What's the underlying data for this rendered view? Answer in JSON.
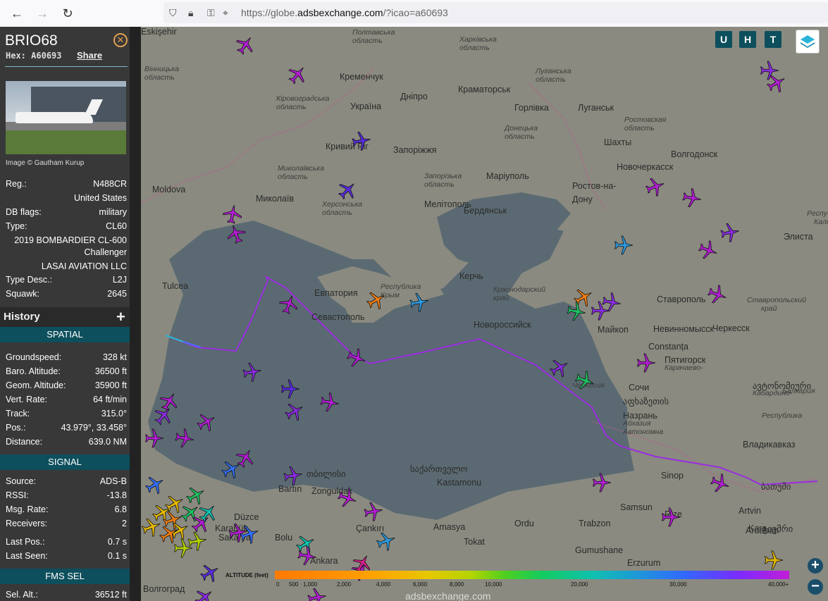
{
  "browser": {
    "url_prefix": "https://globe.",
    "url_domain": "adsbexchange.com",
    "url_path": "/?icao=a60693"
  },
  "aircraft": {
    "callsign": "BRIO68",
    "hex_label": "Hex:",
    "hex": "A60693",
    "share_label": "Share",
    "photo_credit": "Image © Gautham Kurup",
    "details": [
      {
        "key": "Reg.:",
        "value": "N488CR"
      },
      {
        "key": "",
        "value": "United States"
      },
      {
        "key": "DB flags:",
        "value": "military"
      },
      {
        "key": "Type:",
        "value": "CL60"
      }
    ],
    "model_line1": "2019 BOMBARDIER CL-600",
    "model_line2": "Challenger",
    "operator": "LASAI AVIATION LLC",
    "details2": [
      {
        "key": "Type Desc.:",
        "value": "L2J"
      },
      {
        "key": "Squawk:",
        "value": "2645"
      }
    ]
  },
  "history": {
    "title": "History",
    "add_symbol": "+"
  },
  "spatial": {
    "title": "SPATIAL",
    "rows": [
      {
        "key": "Groundspeed:",
        "value": "328 kt"
      },
      {
        "key": "Baro. Altitude:",
        "value": "36500 ft"
      },
      {
        "key": "Geom. Altitude:",
        "value": "35900 ft"
      },
      {
        "key": "Vert. Rate:",
        "value": "64 ft/min"
      },
      {
        "key": "Track:",
        "value": "315.0°"
      },
      {
        "key": "Pos.:",
        "value": "43.979°, 33.458°"
      },
      {
        "key": "Distance:",
        "value": "639.0 NM"
      }
    ]
  },
  "signal": {
    "title": "SIGNAL",
    "rows": [
      {
        "key": "Source:",
        "value": "ADS-B"
      },
      {
        "key": "RSSI:",
        "value": "-13.8"
      },
      {
        "key": "Msg. Rate:",
        "value": "6.8"
      },
      {
        "key": "Receivers:",
        "value": "2"
      },
      {
        "key": "Last Pos.:",
        "value": "0.7 s"
      },
      {
        "key": "Last Seen:",
        "value": "0.1 s"
      }
    ]
  },
  "fms": {
    "title": "FMS SEL",
    "rows": [
      {
        "key": "Sel. Alt.:",
        "value": "36512 ft"
      }
    ]
  },
  "map": {
    "buttons": [
      "U",
      "H",
      "T"
    ],
    "labels": [
      {
        "t": "Полтавська",
        "c": "obl"
      },
      {
        "t": "область",
        "c": "obl"
      },
      {
        "t": "Харківська",
        "c": "obl"
      },
      {
        "t": "область",
        "c": "obl"
      },
      {
        "t": "Кременчук",
        "c": ""
      },
      {
        "t": "Краматорськ",
        "c": ""
      },
      {
        "t": "Луганська",
        "c": "obl"
      },
      {
        "t": "область",
        "c": "obl"
      },
      {
        "t": "Вінницька",
        "c": "obl"
      },
      {
        "t": "область",
        "c": "obl"
      },
      {
        "t": "Кіровоградська",
        "c": "obl"
      },
      {
        "t": "область",
        "c": "obl"
      },
      {
        "t": "Україна",
        "c": ""
      },
      {
        "t": "Дніпро",
        "c": ""
      },
      {
        "t": "Горлівка",
        "c": ""
      },
      {
        "t": "Луганськ",
        "c": ""
      },
      {
        "t": "Ростовская",
        "c": "obl"
      },
      {
        "t": "область",
        "c": "obl"
      },
      {
        "t": "Донецька",
        "c": "obl"
      },
      {
        "t": "область",
        "c": "obl"
      },
      {
        "t": "Шахты",
        "c": ""
      },
      {
        "t": "Кривий Ріг",
        "c": ""
      },
      {
        "t": "Запоріжжя",
        "c": ""
      },
      {
        "t": "Волгодонск",
        "c": ""
      },
      {
        "t": "Миколаївська",
        "c": "obl"
      },
      {
        "t": "область",
        "c": "obl"
      },
      {
        "t": "Запорізька",
        "c": "obl"
      },
      {
        "t": "область",
        "c": "obl"
      },
      {
        "t": "Маріуполь",
        "c": ""
      },
      {
        "t": "Новочеркасск",
        "c": ""
      },
      {
        "t": "Moldova",
        "c": ""
      },
      {
        "t": "Миколаїв",
        "c": ""
      },
      {
        "t": "Херсонська",
        "c": "obl"
      },
      {
        "t": "область",
        "c": "obl"
      },
      {
        "t": "Мелітополь",
        "c": ""
      },
      {
        "t": "Бердянськ",
        "c": ""
      },
      {
        "t": "Ростов-на-",
        "c": ""
      },
      {
        "t": "Дону",
        "c": ""
      },
      {
        "t": "Республи",
        "c": "obl"
      },
      {
        "t": "Калмы",
        "c": "obl"
      },
      {
        "t": "Элиста",
        "c": ""
      },
      {
        "t": "Tulcea",
        "c": ""
      },
      {
        "t": "Евпатория",
        "c": ""
      },
      {
        "t": "Республика",
        "c": "obl"
      },
      {
        "t": "Крым",
        "c": "obl"
      },
      {
        "t": "Керчь",
        "c": ""
      },
      {
        "t": "Краснодарский",
        "c": "obl"
      },
      {
        "t": "край",
        "c": "obl"
      },
      {
        "t": "Ставрополь",
        "c": ""
      },
      {
        "t": "Ставропольский",
        "c": "obl"
      },
      {
        "t": "край",
        "c": "obl"
      },
      {
        "t": "Севастополь",
        "c": ""
      },
      {
        "t": "Новороссийск",
        "c": ""
      },
      {
        "t": "Майкоп",
        "c": ""
      },
      {
        "t": "Невинномысск",
        "c": ""
      },
      {
        "t": "Constanța",
        "c": ""
      },
      {
        "t": "Черкесск",
        "c": ""
      },
      {
        "t": "Пятигорск",
        "c": ""
      },
      {
        "t": "Карачаево-",
        "c": "obl"
      },
      {
        "t": "Черкесия",
        "c": "obl"
      },
      {
        "t": "Сочи",
        "c": ""
      },
      {
        "t": "აფხაზეთის",
        "c": ""
      },
      {
        "t": "ავტონომიური",
        "c": ""
      },
      {
        "t": "Кабардино-",
        "c": "obl"
      },
      {
        "t": "Балкария",
        "c": "obl"
      },
      {
        "t": "Назрань",
        "c": ""
      },
      {
        "t": "Абхазия",
        "c": "obl"
      },
      {
        "t": "Автономна",
        "c": "obl"
      },
      {
        "t": "Республика",
        "c": "obl"
      },
      {
        "t": "Владикавказ",
        "c": ""
      },
      {
        "t": "საქართველო",
        "c": ""
      },
      {
        "t": "Sinop",
        "c": ""
      },
      {
        "t": "ბათუმი",
        "c": ""
      },
      {
        "t": "თბილისი",
        "c": ""
      },
      {
        "t": "Bartın",
        "c": ""
      },
      {
        "t": "Zonguldak",
        "c": ""
      },
      {
        "t": "Kastamonu",
        "c": ""
      },
      {
        "t": "Samsun",
        "c": ""
      },
      {
        "t": "Rize",
        "c": ""
      },
      {
        "t": "Artvin",
        "c": ""
      },
      {
        "t": "Ardahan",
        "c": ""
      },
      {
        "t": "Düzce",
        "c": ""
      },
      {
        "t": "Karabük",
        "c": ""
      },
      {
        "t": "Çankırı",
        "c": ""
      },
      {
        "t": "Amasya",
        "c": ""
      },
      {
        "t": "Ordu",
        "c": ""
      },
      {
        "t": "Trabzon",
        "c": ""
      },
      {
        "t": "Kars",
        "c": ""
      },
      {
        "t": "გიუმრი",
        "c": ""
      },
      {
        "t": "Sakarya",
        "c": ""
      },
      {
        "t": "Bolu",
        "c": ""
      },
      {
        "t": "Tokat",
        "c": ""
      },
      {
        "t": "Gumushane",
        "c": ""
      },
      {
        "t": "Ankara",
        "c": ""
      },
      {
        "t": "Erzurum",
        "c": ""
      },
      {
        "t": "Волгоград",
        "c": ""
      },
      {
        "t": "Eskişehir",
        "c": ""
      }
    ],
    "altitude": {
      "title": "ALTITUDE (feet)",
      "ticks": [
        "0",
        "500",
        "1,000",
        "2,000",
        "4,000",
        "6,000",
        "8,000",
        "10,000",
        "20,000",
        "30,000",
        "40,000+"
      ]
    },
    "watermark": "adsbexchange.com",
    "zoom_in": "+",
    "zoom_out": "−"
  }
}
